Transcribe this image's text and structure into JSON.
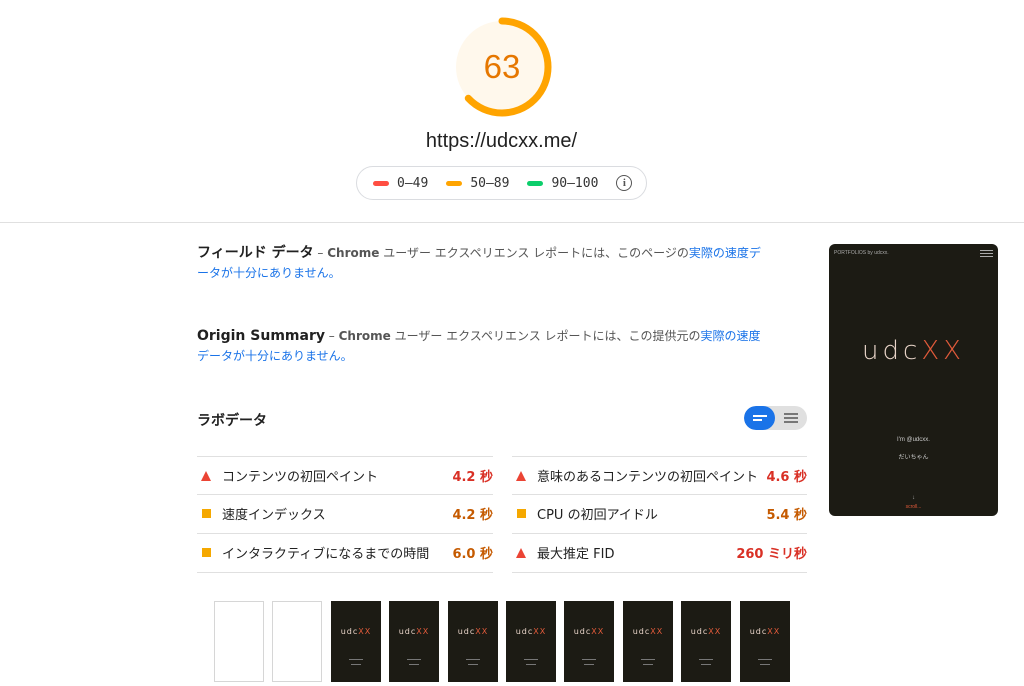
{
  "score": {
    "value": "63",
    "fraction": 0.63,
    "color": "#ffa400"
  },
  "url": "https://udcxx.me/",
  "legend": [
    {
      "label": "0–49",
      "color": "#ff4e42"
    },
    {
      "label": "50–89",
      "color": "#ffa400"
    },
    {
      "label": "90–100",
      "color": "#0cce6b"
    }
  ],
  "field_data": {
    "title": "フィールド データ",
    "dash": " – ",
    "chrome": "Chrome",
    "text": " ユーザー エクスペリエンス レポートには、このページの",
    "link": "実際の速度データが十分にありません。"
  },
  "origin_summary": {
    "title": "Origin Summary",
    "dash": " – ",
    "chrome": "Chrome",
    "text": " ユーザー エクスペリエンス レポートには、この提供元の",
    "link": "実際の速度データが十分にありません。"
  },
  "lab_data": {
    "title": "ラボデータ"
  },
  "metrics_left": [
    {
      "icon": "triangle",
      "label": "コンテンツの初回ペイント",
      "value": "4.2 秒",
      "color": "red"
    },
    {
      "icon": "square",
      "label": "速度インデックス",
      "value": "4.2 秒",
      "color": "orange"
    },
    {
      "icon": "square",
      "label": "インタラクティブになるまでの時間",
      "value": "6.0 秒",
      "color": "orange"
    }
  ],
  "metrics_right": [
    {
      "icon": "triangle",
      "label": "意味のあるコンテンツの初回ペイント",
      "value": "4.6 秒",
      "color": "red"
    },
    {
      "icon": "square",
      "label": "CPU の初回アイドル",
      "value": "5.4 秒",
      "color": "orange"
    },
    {
      "icon": "triangle",
      "label": "最大推定 FID",
      "value": "260 ミリ秒",
      "color": "red"
    }
  ],
  "screenshot": {
    "top_text": "PORTFOLIOS by udcxx.",
    "logo_main": "udc",
    "logo_accent": "XX",
    "line1": "I'm @udcxx.",
    "line2": "だいちゃん",
    "arrow": "↓",
    "scroll": "scroll..."
  },
  "filmstrip": {
    "frames": [
      "blank",
      "blank",
      "dark",
      "dark",
      "dark",
      "dark",
      "dark",
      "dark",
      "dark",
      "dark"
    ],
    "logo_main": "udc",
    "logo_accent": "XX"
  }
}
